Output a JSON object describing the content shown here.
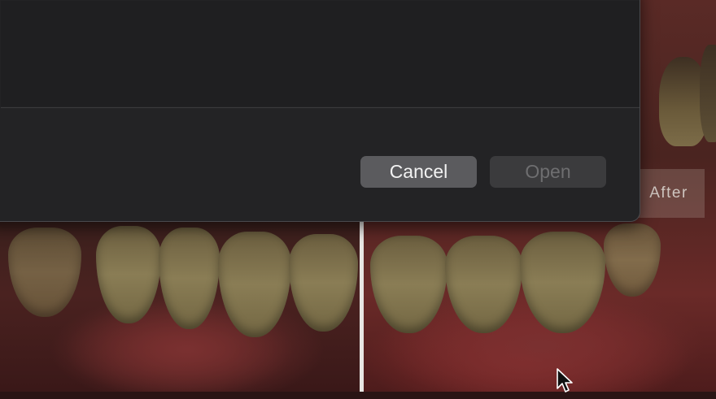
{
  "dialog": {
    "cancel_label": "Cancel",
    "open_label": "Open",
    "open_enabled": false
  },
  "photo": {
    "after_label": "After"
  },
  "icons": {
    "cursor": "arrow-cursor-icon"
  }
}
